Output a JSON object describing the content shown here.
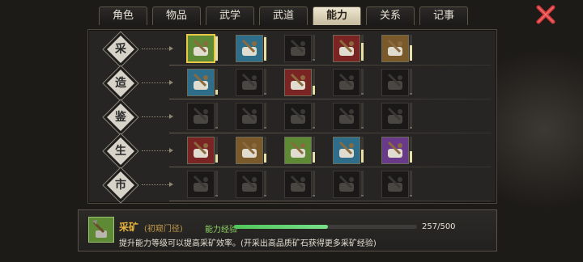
{
  "tabs": [
    {
      "label": "角色",
      "active": false
    },
    {
      "label": "物品",
      "active": false
    },
    {
      "label": "武学",
      "active": false
    },
    {
      "label": "武道",
      "active": false
    },
    {
      "label": "能力",
      "active": true
    },
    {
      "label": "关系",
      "active": false
    },
    {
      "label": "记事",
      "active": false
    }
  ],
  "categories": [
    {
      "label": "采",
      "slots": [
        {
          "icon": "ore-shovel-icon",
          "active": true,
          "level": 0.95
        },
        {
          "icon": "wood-axe-icon",
          "active": true,
          "level": 0.9
        },
        {
          "icon": "pot-icon",
          "active": false,
          "level": 0.0
        },
        {
          "icon": "herb-hoe-icon",
          "active": true,
          "level": 0.7
        },
        {
          "icon": "fishing-rod-icon",
          "active": true,
          "level": 0.6
        }
      ]
    },
    {
      "label": "造",
      "slots": [
        {
          "icon": "anvil-icon",
          "active": true,
          "level": 0.2
        },
        {
          "icon": "armor-icon",
          "active": false,
          "level": 0.0
        },
        {
          "icon": "scissors-icon",
          "active": true,
          "level": 0.35
        },
        {
          "icon": "pestle-icon",
          "active": false,
          "level": 0.0
        },
        {
          "icon": "cooking-icon",
          "active": false,
          "level": 0.0
        }
      ]
    },
    {
      "label": "鉴",
      "slots": [
        {
          "icon": "tablet-icon",
          "active": false,
          "level": 0.0
        },
        {
          "icon": "cloth-icon",
          "active": false,
          "level": 0.0
        },
        {
          "icon": "gem-icon",
          "active": false,
          "level": 0.0
        },
        {
          "icon": "hat-icon",
          "active": false,
          "level": 0.0
        },
        {
          "icon": "stone-icon",
          "active": false,
          "level": 0.0
        }
      ]
    },
    {
      "label": "生",
      "slots": [
        {
          "icon": "dentures-icon",
          "active": true,
          "level": 0.3
        },
        {
          "icon": "chess-board-icon",
          "active": true,
          "level": 0.35
        },
        {
          "icon": "drum-icon",
          "active": true,
          "level": 0.4
        },
        {
          "icon": "scroll-map-icon",
          "active": true,
          "level": 0.5
        },
        {
          "icon": "whip-coil-icon",
          "active": true,
          "level": 0.45
        }
      ]
    },
    {
      "label": "市",
      "slots": [
        {
          "icon": "sack-icon",
          "active": false,
          "level": 0.0
        },
        {
          "icon": "cloth-bolt-icon",
          "active": false,
          "level": 0.0
        },
        {
          "icon": "teapot-icon",
          "active": false,
          "level": 0.0
        },
        {
          "icon": "ornament-icon",
          "active": false,
          "level": 0.0
        },
        {
          "icon": "rope-icon",
          "active": false,
          "level": 0.0
        }
      ]
    }
  ],
  "detail": {
    "name": "采矿",
    "rank": "(初窥门径)",
    "exp_label": "能力经验",
    "exp_current": 257,
    "exp_max": 500,
    "exp_text": "257/500",
    "description": "提升能力等级可以提高采矿效率。(开采出高品质矿石获得更多采矿经验)",
    "icon": "ore-shovel-icon"
  },
  "colors": {
    "accent_gold": "#e8c846",
    "exp_green": "#4fc75b",
    "close_red": "#d63a3a",
    "active_slot_green": "#5f8a35",
    "active_slot_blue": "#2e6e8a",
    "active_slot_purple": "#6a3a8a",
    "active_slot_red": "#7a2424"
  }
}
